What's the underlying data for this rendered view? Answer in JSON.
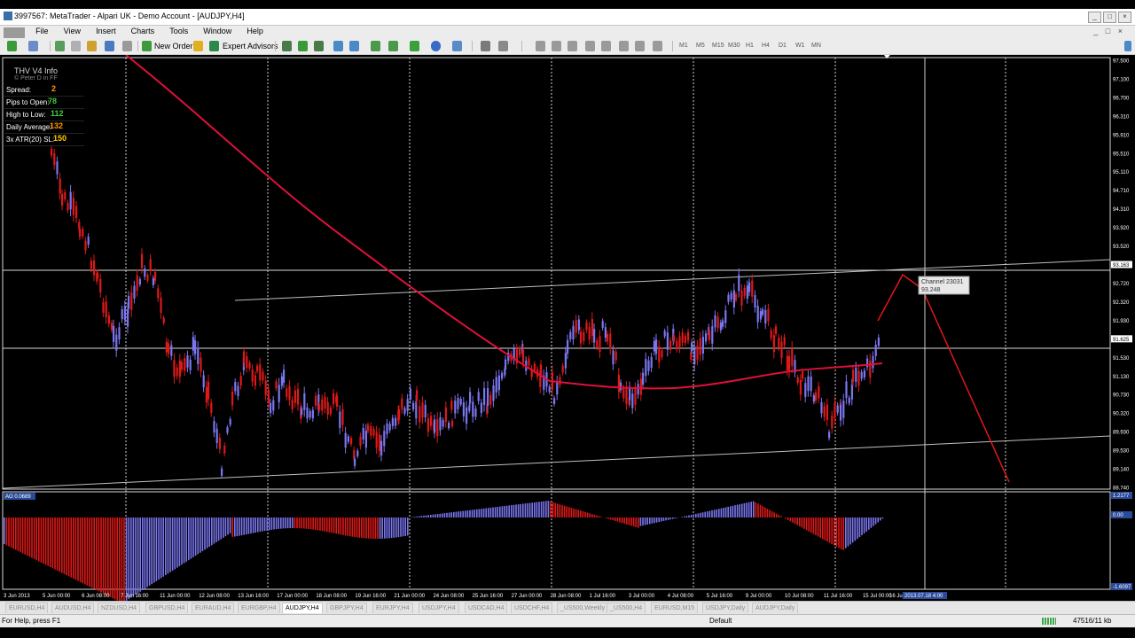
{
  "window": {
    "title": "3997567: MetaTrader - Alpari UK - Demo Account - [AUDJPY,H4]",
    "controls": [
      "_",
      "□",
      "×"
    ]
  },
  "menu": {
    "items": [
      "File",
      "View",
      "Insert",
      "Charts",
      "Tools",
      "Window",
      "Help"
    ]
  },
  "toolbar": {
    "new_order": "New Order",
    "expert_advisors": "Expert Advisors",
    "timeframes": [
      "M1",
      "M5",
      "M15",
      "M30",
      "H1",
      "H4",
      "D1",
      "W1",
      "MN"
    ]
  },
  "info_panel": {
    "title": "THV  V4  Info",
    "subtitle": "© Peter D in FF",
    "rows": [
      {
        "label": "Spread:",
        "value": "2",
        "color": "#ff9900"
      },
      {
        "label": "Pips to Open:",
        "value": "78",
        "color": "#3ecf3e"
      },
      {
        "label": "High to Low:",
        "value": "112",
        "color": "#3ecf3e"
      },
      {
        "label": "Daily Average:",
        "value": "132",
        "color": "#ff9900"
      },
      {
        "label": "3x ATR(20) SL:",
        "value": "150",
        "color": "#ffcc00"
      }
    ]
  },
  "chart": {
    "symbol": "AUDJPY,H4",
    "price_labels": [
      "97.500",
      "97.100",
      "96.700",
      "96.310",
      "95.910",
      "95.510",
      "95.110",
      "94.710",
      "94.310",
      "93.920",
      "93.520",
      "93.163",
      "92.720",
      "92.320",
      "91.930",
      "91.625",
      "91.530",
      "91.130",
      "90.730",
      "90.320",
      "89.930",
      "89.530",
      "89.140",
      "88.740"
    ],
    "current_price_labels": [
      "93.163",
      "91.625"
    ],
    "time_labels": [
      "3 Jun 2013",
      "5 Jun 00:00",
      "6 Jun 08:00",
      "7 Jun 16:00",
      "11 Jun 00:00",
      "12 Jun 08:00",
      "13 Jun 16:00",
      "17 Jun 00:00",
      "18 Jun 08:00",
      "19 Jun 16:00",
      "21 Jun 00:00",
      "24 Jun 08:00",
      "25 Jun 16:00",
      "27 Jun 00:00",
      "28 Jun 08:00",
      "1 Jul 16:00",
      "3 Jul 00:00",
      "4 Jul 08:00",
      "5 Jul 16:00",
      "9 Jul 00:00",
      "10 Jul 08:00",
      "11 Jul 16:00",
      "15 Jul 00:00",
      "16 Jul 08:00"
    ],
    "cursor_time": "2013.07.18 4:00",
    "tooltip": {
      "line1": "Channel 23031",
      "line2": "93.248"
    },
    "ao": {
      "label": "AO 0.0689",
      "scale_top": "1.2177",
      "scale_zero": "0.00",
      "scale_bottom": "-1.6097"
    },
    "colors": {
      "bull": "#7b76f0",
      "bear": "#e01818",
      "ma": "#e0103a",
      "grid": "#cfcfcf",
      "channel": "#bfbfbf"
    }
  },
  "tabs": [
    "EURUSD,H4",
    "AUDUSD,H4",
    "NZDUSD,H4",
    "GBPUSD,H4",
    "EURAUD,H4",
    "EURGBP,H4",
    "AUDJPY,H4",
    "GBPJPY,H4",
    "EURJPY,H4",
    "USDJPY,H4",
    "USDCAD,H4",
    "USDCHF,H4",
    "_US500,Weekly",
    "_US500,H4",
    "EURUSD,M15",
    "USDJPY,Daily",
    "AUDJPY,Daily"
  ],
  "active_tab": 6,
  "status": {
    "help": "For Help, press F1",
    "profile": "Default",
    "traffic": "47516/11 kb"
  }
}
